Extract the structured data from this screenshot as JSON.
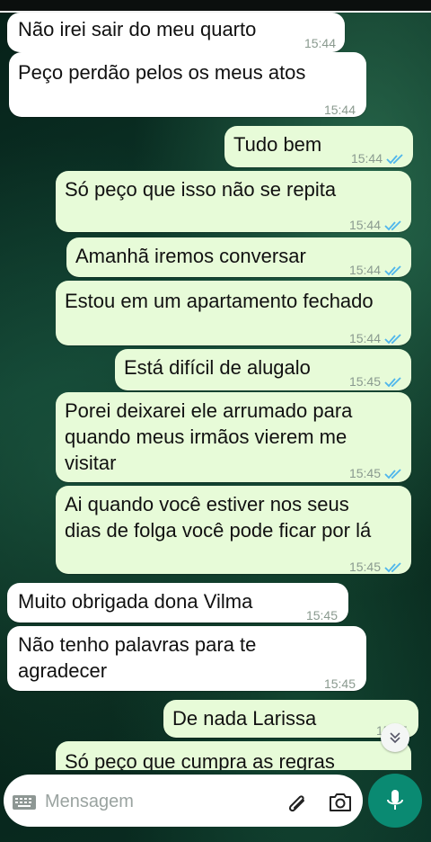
{
  "messages": [
    {
      "text": "Não irei sair do meu quarto",
      "time": "15:44",
      "dir": "in"
    },
    {
      "text": "Peço perdão pelos os meus atos",
      "time": "15:44",
      "dir": "in"
    },
    {
      "text": "Tudo bem",
      "time": "15:44",
      "dir": "out",
      "status": "read"
    },
    {
      "text": "Só peço que isso não se repita",
      "time": "15:44",
      "dir": "out",
      "status": "read"
    },
    {
      "text": "Amanhã iremos conversar",
      "time": "15:44",
      "dir": "out",
      "status": "read"
    },
    {
      "text": "Estou em um apartamento fechado",
      "time": "15:44",
      "dir": "out",
      "status": "read"
    },
    {
      "text": "Está difícil de alugalo",
      "time": "15:45",
      "dir": "out",
      "status": "read"
    },
    {
      "text": "Porei deixarei ele arrumado para\nquando meus irmãos vierem me\nvisitar",
      "time": "15:45",
      "dir": "out",
      "status": "read"
    },
    {
      "text": "Ai quando você estiver nos seus\ndias de folga você pode ficar por lá",
      "time": "15:45",
      "dir": "out",
      "status": "read"
    },
    {
      "text": "Muito obrigada dona Vilma",
      "time": "15:45",
      "dir": "in"
    },
    {
      "text": "Não tenho palavras para te\nagradecer",
      "time": "15:45",
      "dir": "in"
    },
    {
      "text": "De nada Larissa",
      "time": "15:45",
      "dir": "out",
      "status": "read"
    },
    {
      "text": "Só peço que cumpra as regras",
      "time": "",
      "dir": "out"
    }
  ],
  "composer": {
    "placeholder": "Mensagem",
    "keyboard_icon": "keyboard-icon",
    "attach_icon": "paperclip-icon",
    "camera_icon": "camera-icon",
    "mic_icon": "microphone-icon"
  },
  "colors": {
    "incoming_bubble": "#ffffff",
    "outgoing_bubble": "#e7fbd8",
    "read_ticks": "#4fb6ec",
    "mic_button": "#0a8a72"
  }
}
